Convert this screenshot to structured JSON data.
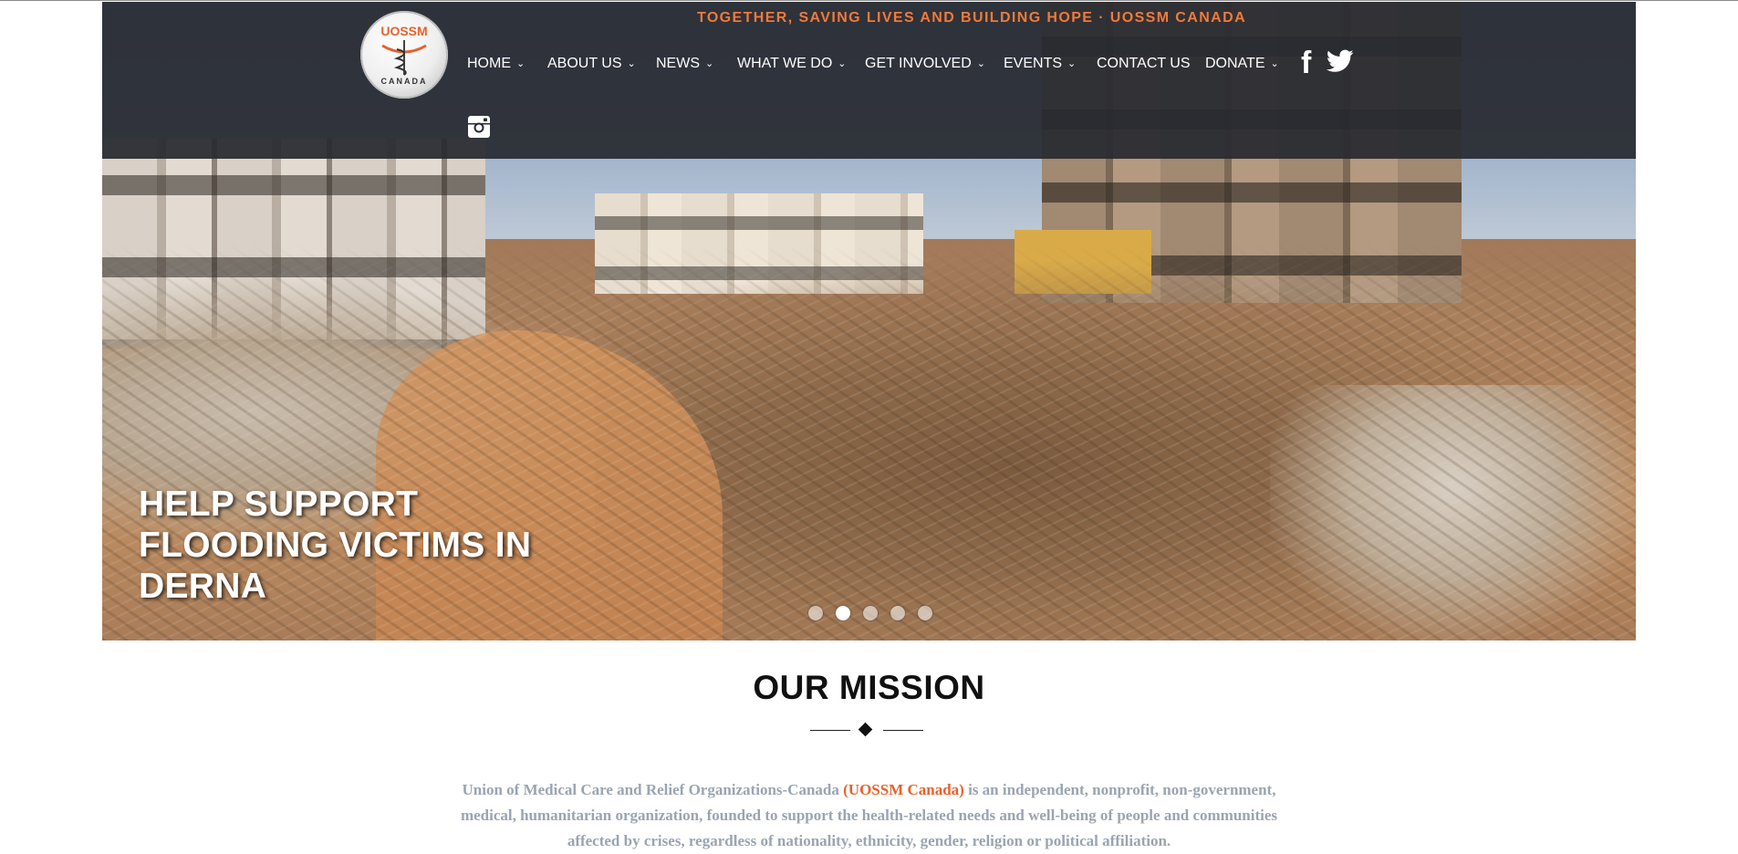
{
  "tagline": "TOGETHER, SAVING LIVES AND BUILDING HOPE · UOSSM CANADA",
  "logo": {
    "top_text": "UOSSM",
    "bottom_text": "CANADA"
  },
  "nav": {
    "items": [
      {
        "label": "HOME",
        "has_dropdown": true
      },
      {
        "label": "ABOUT US",
        "has_dropdown": true
      },
      {
        "label": "NEWS",
        "has_dropdown": true
      },
      {
        "label": "WHAT WE DO",
        "has_dropdown": true
      },
      {
        "label": "GET INVOLVED",
        "has_dropdown": true
      },
      {
        "label": "EVENTS",
        "has_dropdown": true
      },
      {
        "label": "CONTACT US",
        "has_dropdown": false
      },
      {
        "label": "DONATE",
        "has_dropdown": true
      }
    ],
    "chevron": "⌄"
  },
  "social": {
    "facebook_glyph": "f",
    "icons": [
      "facebook-icon",
      "twitter-icon",
      "instagram-icon"
    ]
  },
  "hero": {
    "caption": "HELP SUPPORT FLOODING VICTIMS IN DERNA",
    "slide_count": 5,
    "active_slide": 2
  },
  "mission": {
    "title": "OUR MISSION",
    "text_part1": "Union of Medical Care and Relief Organizations-Canada ",
    "text_brand": "(UOSSM Canada)",
    "text_part2": " is an independent, nonprofit, non-government, medical, humanitarian organization, founded to support the health-related needs and well-being of people and communities affected by crises, regardless of nationality, ethnicity, gender, religion or political affiliation."
  },
  "colors": {
    "accent": "#f07a3b",
    "brand_orange": "#e8612a",
    "header_bg": "#282a30",
    "mission_text": "#9ba4b1"
  }
}
